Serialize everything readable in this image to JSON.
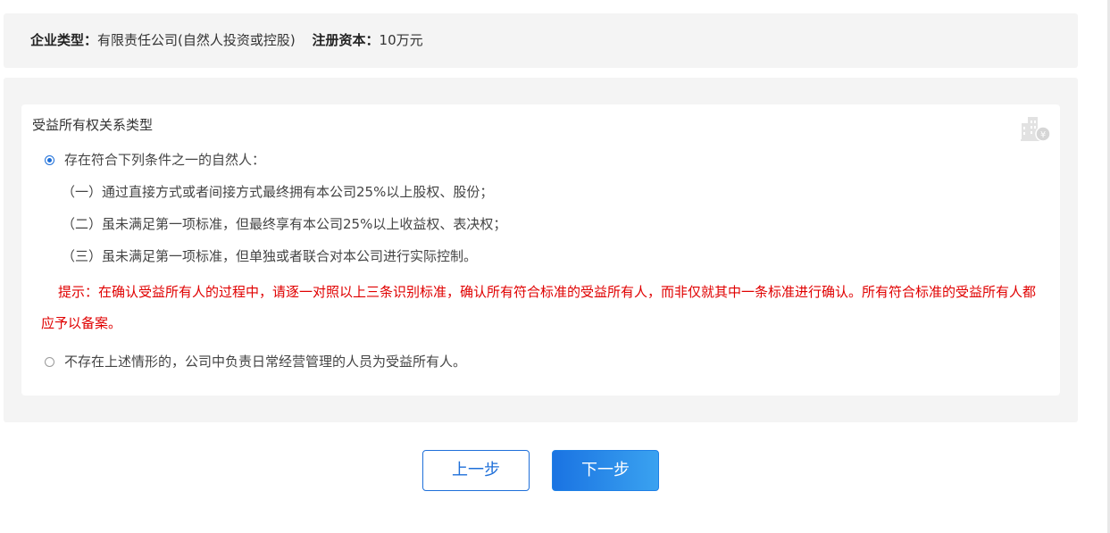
{
  "company": {
    "type_label": "企业类型：",
    "type_value": "有限责任公司(自然人投资或控股)",
    "capital_label": "注册资本：",
    "capital_value": "10万元"
  },
  "beneficial": {
    "title": "受益所有权关系类型",
    "option1_label": "存在符合下列条件之一的自然人：",
    "option1_checked": true,
    "conditions": [
      "（一）通过直接方式或者间接方式最终拥有本公司25%以上股权、股份；",
      "（二）虽未满足第一项标准，但最终享有本公司25%以上收益权、表决权；",
      "（三）虽未满足第一项标准，但单独或者联合对本公司进行实际控制。"
    ],
    "hint": "提示：在确认受益所有人的过程中，请逐一对照以上三条识别标准，确认所有符合标准的受益所有人，而非仅就其中一条标准进行确认。所有符合标准的受益所有人都应予以备案。",
    "option2_label": "不存在上述情形的，公司中负责日常经营管理的人员为受益所有人。",
    "option2_checked": false,
    "corner_icon": "building-yen-icon"
  },
  "buttons": {
    "prev_label": "上一步",
    "next_label": "下一步"
  },
  "colors": {
    "accent": "#1e6fd9",
    "hint": "#e00000",
    "panel_bg": "#f4f4f4"
  }
}
